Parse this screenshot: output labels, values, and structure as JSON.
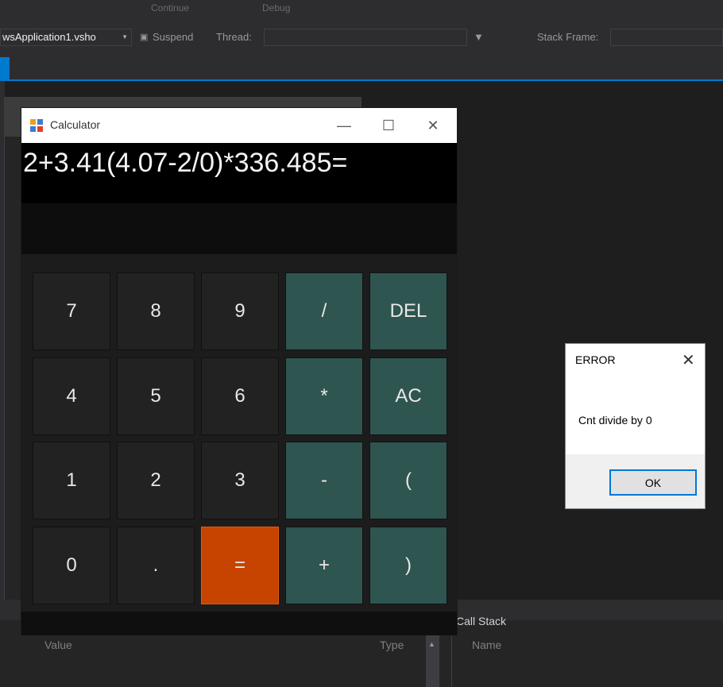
{
  "ide": {
    "toolbar_top": {
      "continue_label": "Continue",
      "debug_label": "Debug"
    },
    "toolbar": {
      "project_selector": "wsApplication1.vsho",
      "suspend_label": "Suspend",
      "thread_label": "Thread:",
      "stack_frame_label": "Stack Frame:"
    },
    "bottom_left": {
      "value_col": "Value",
      "type_col": "Type"
    },
    "call_stack": {
      "title": "Call Stack",
      "name_col": "Name"
    }
  },
  "calculator": {
    "title": "Calculator",
    "window_controls": {
      "minimize": "—",
      "maximize": "☐",
      "close": "✕"
    },
    "expression": "2+3.41(4.07-2/0)*336.485=",
    "result": "",
    "keys": {
      "k7": "7",
      "k8": "8",
      "k9": "9",
      "div": "/",
      "del": "DEL",
      "k4": "4",
      "k5": "5",
      "k6": "6",
      "mul": "*",
      "ac": "AC",
      "k1": "1",
      "k2": "2",
      "k3": "3",
      "sub": "-",
      "lparen": "(",
      "k0": "0",
      "dot": ".",
      "eq": "=",
      "add": "+",
      "rparen": ")"
    },
    "colors": {
      "operator_key": "#2f5550",
      "number_key": "#222222",
      "equals_key": "#c64400"
    }
  },
  "error_dialog": {
    "title": "ERROR",
    "close": "✕",
    "message": "Cnt divide by 0",
    "ok_label": "OK"
  }
}
